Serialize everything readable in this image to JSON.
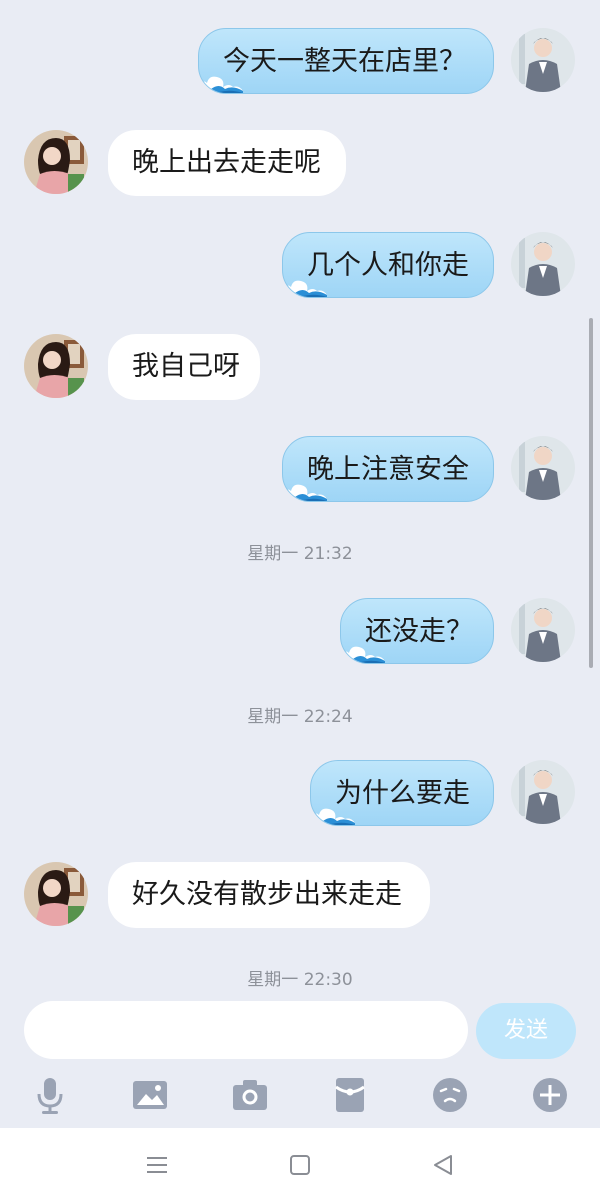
{
  "messages": [
    {
      "from": "me",
      "text": "今天一整天在店里？"
    },
    {
      "from": "her",
      "text": "晚上出去走走呢"
    },
    {
      "from": "me",
      "text": "几个人和你走"
    },
    {
      "from": "her",
      "text": "我自己呀"
    },
    {
      "from": "me",
      "text": "晚上注意安全"
    },
    {
      "from": "me",
      "text": "还没走？"
    },
    {
      "from": "me",
      "text": "为什么要走"
    },
    {
      "from": "her",
      "text": "好久没有散步出来走走"
    }
  ],
  "timestamps": [
    "星期一 21:32",
    "星期一 22:24",
    "星期一 22:30"
  ],
  "input": {
    "value": "",
    "placeholder": ""
  },
  "send_label": "发送",
  "toolbar_icons": [
    "microphone-icon",
    "image-icon",
    "camera-icon",
    "red-packet-icon",
    "emoji-icon",
    "plus-icon"
  ],
  "nav_icons": [
    "menu-icon",
    "home-icon",
    "back-icon"
  ],
  "colors": {
    "background": "#e9ecf4",
    "my_bubble": "#a8daf8",
    "her_bubble": "#ffffff",
    "icon": "#9aa3b4",
    "send_button": "#bfe6fb"
  }
}
